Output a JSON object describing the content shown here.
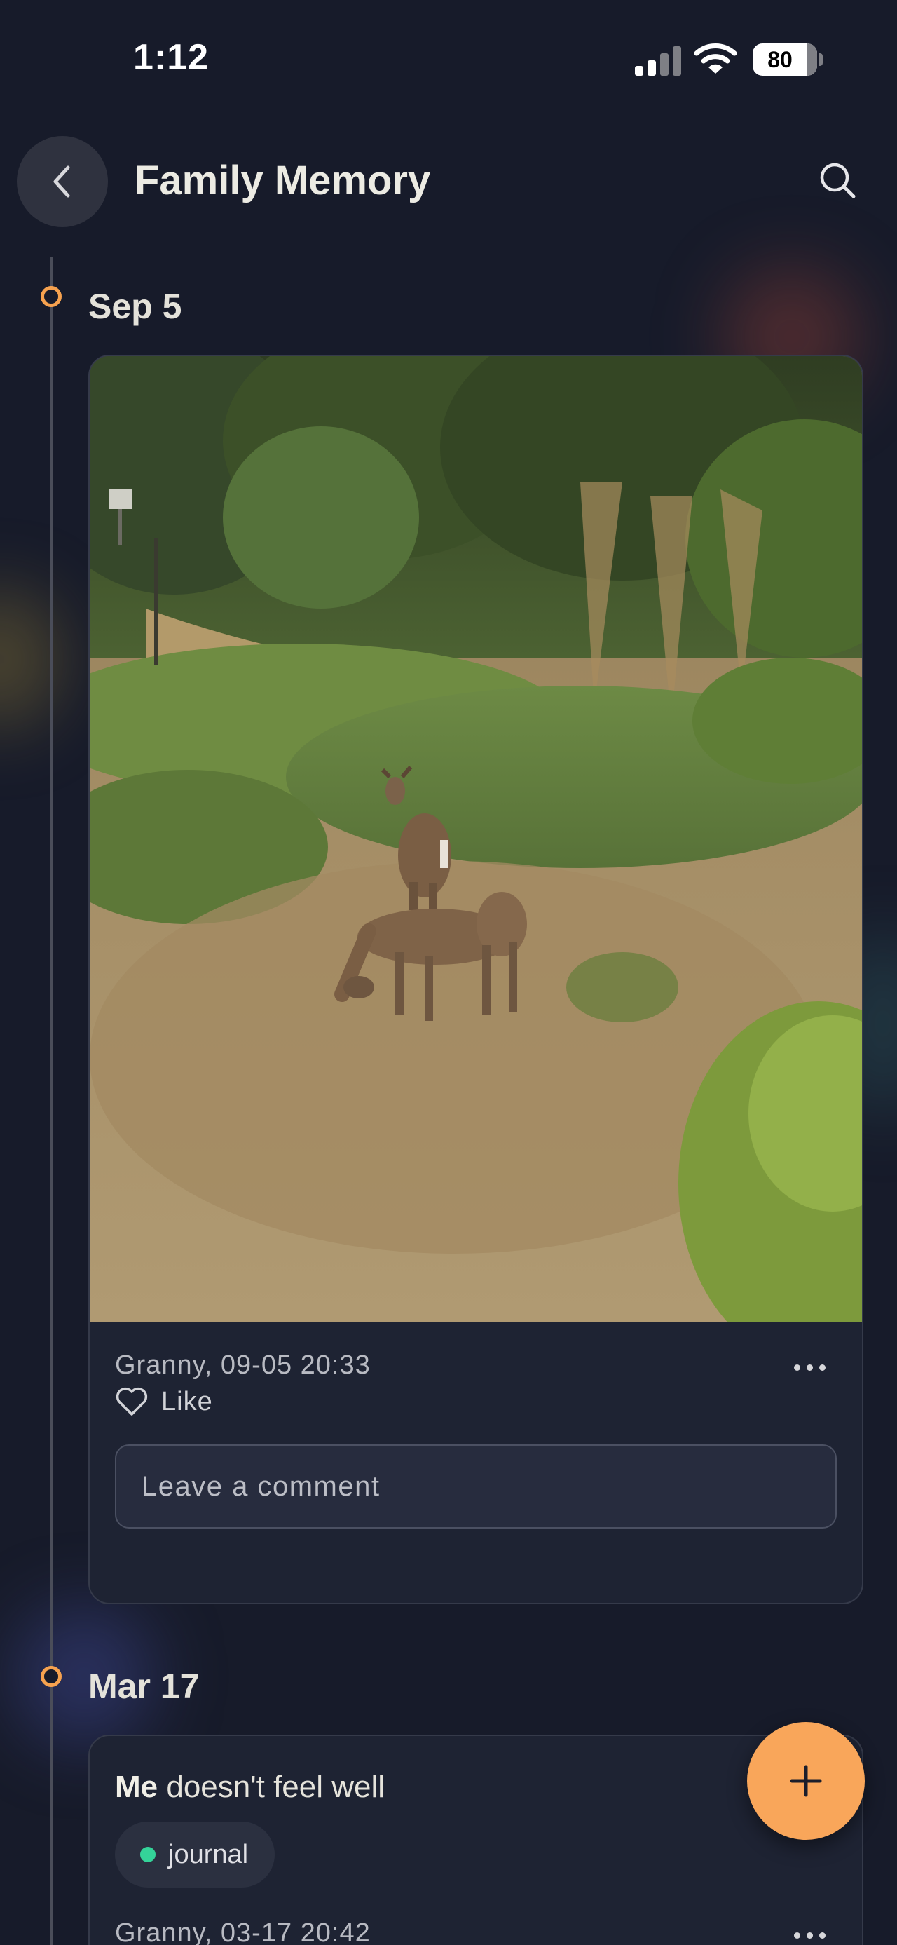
{
  "status_bar": {
    "time": "1:12",
    "battery": "80",
    "signal_icon": "cellular-signal-icon",
    "wifi_icon": "wifi-icon"
  },
  "header": {
    "title": "Family Memory",
    "back_icon": "chevron-left-icon",
    "search_icon": "search-icon"
  },
  "timeline": {
    "entries": [
      {
        "date": "Sep 5",
        "type": "photo",
        "photo_subject": "two deer grazing in a dry grassy field with shrubs and trees",
        "meta": "Granny, 09-05 20:33",
        "like_label": "Like",
        "comment_placeholder": "Leave a comment"
      },
      {
        "date": "Mar 17",
        "type": "journal",
        "title_author": "Me",
        "title_text": " doesn't feel well",
        "tag": "journal",
        "meta": "Granny, 03-17 20:42"
      }
    ]
  },
  "fab": {
    "icon": "plus-icon"
  },
  "colors": {
    "background": "#171b2a",
    "card": "#1e2333",
    "accent": "#f9a65a",
    "tag_dot": "#34d399"
  }
}
